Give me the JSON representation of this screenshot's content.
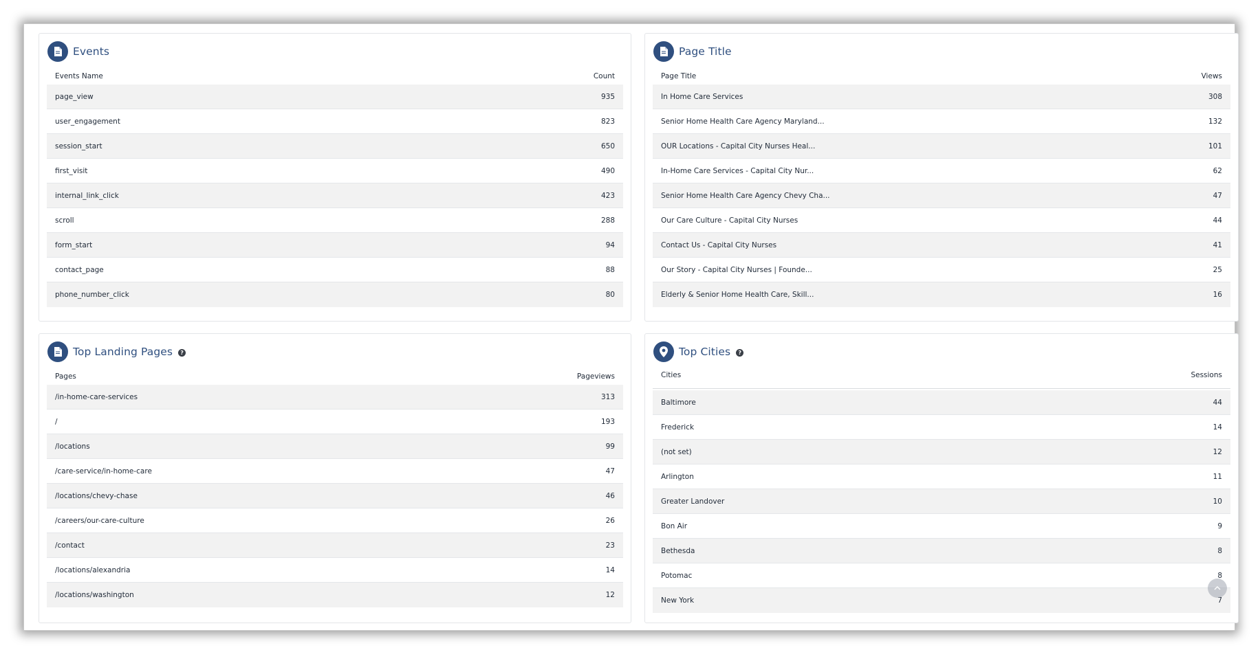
{
  "colors": {
    "accent": "#2f4f7f",
    "row_alt": "#f2f2f2"
  },
  "events": {
    "title": "Events",
    "icon": "document-icon",
    "col_name": "Events Name",
    "col_value": "Count",
    "rows": [
      {
        "name": "page_view",
        "value": "935"
      },
      {
        "name": "user_engagement",
        "value": "823"
      },
      {
        "name": "session_start",
        "value": "650"
      },
      {
        "name": "first_visit",
        "value": "490"
      },
      {
        "name": "internal_link_click",
        "value": "423"
      },
      {
        "name": "scroll",
        "value": "288"
      },
      {
        "name": "form_start",
        "value": "94"
      },
      {
        "name": "contact_page",
        "value": "88"
      },
      {
        "name": "phone_number_click",
        "value": "80"
      }
    ]
  },
  "page_title": {
    "title": "Page Title",
    "icon": "document-icon",
    "col_name": "Page Title",
    "col_value": "Views",
    "rows": [
      {
        "name": "In Home Care Services",
        "value": "308"
      },
      {
        "name": "Senior Home Health Care Agency Maryland...",
        "value": "132"
      },
      {
        "name": "OUR Locations - Capital City Nurses Heal...",
        "value": "101"
      },
      {
        "name": "In-Home Care Services - Capital City Nur...",
        "value": "62"
      },
      {
        "name": "Senior Home Health Care Agency Chevy Cha...",
        "value": "47"
      },
      {
        "name": "Our Care Culture - Capital City Nurses",
        "value": "44"
      },
      {
        "name": "Contact Us - Capital City Nurses",
        "value": "41"
      },
      {
        "name": "Our Story - Capital City Nurses | Founde...",
        "value": "25"
      },
      {
        "name": "Elderly & Senior Home Health Care, Skill...",
        "value": "16"
      }
    ]
  },
  "landing_pages": {
    "title": "Top Landing Pages",
    "icon": "document-icon",
    "col_name": "Pages",
    "col_value": "Pageviews",
    "rows": [
      {
        "name": "/in-home-care-services",
        "value": "313"
      },
      {
        "name": "/",
        "value": "193"
      },
      {
        "name": "/locations",
        "value": "99"
      },
      {
        "name": "/care-service/in-home-care",
        "value": "47"
      },
      {
        "name": "/locations/chevy-chase",
        "value": "46"
      },
      {
        "name": "/careers/our-care-culture",
        "value": "26"
      },
      {
        "name": "/contact",
        "value": "23"
      },
      {
        "name": "/locations/alexandria",
        "value": "14"
      },
      {
        "name": "/locations/washington",
        "value": "12"
      }
    ]
  },
  "top_cities": {
    "title": "Top Cities",
    "icon": "map-pin-icon",
    "col_name": "Cities",
    "col_value": "Sessions",
    "rows": [
      {
        "name": "Baltimore",
        "value": "44"
      },
      {
        "name": "Frederick",
        "value": "14"
      },
      {
        "name": "(not set)",
        "value": "12"
      },
      {
        "name": "Arlington",
        "value": "11"
      },
      {
        "name": "Greater Landover",
        "value": "10"
      },
      {
        "name": "Bon Air",
        "value": "9"
      },
      {
        "name": "Bethesda",
        "value": "8"
      },
      {
        "name": "Potomac",
        "value": "8"
      },
      {
        "name": "New York",
        "value": "7"
      }
    ]
  },
  "help_glyph": "?"
}
